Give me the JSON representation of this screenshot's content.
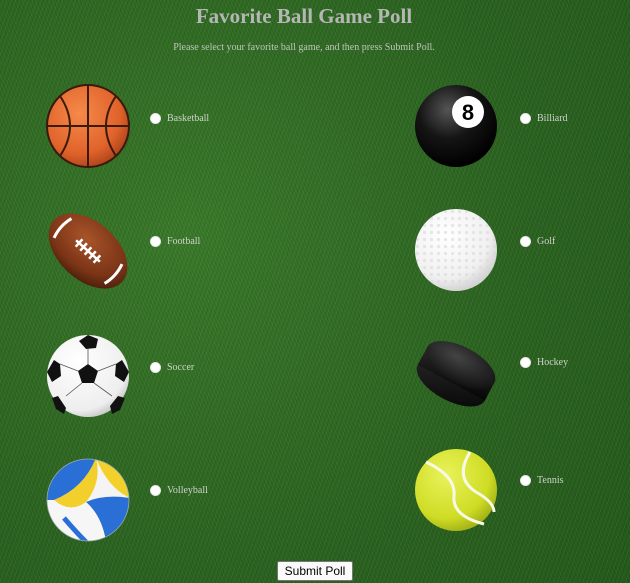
{
  "poll": {
    "title": "Favorite Ball Game Poll",
    "instructions": "Please select your favorite ball game, and then press Submit Poll.",
    "submit_label": "Submit Poll",
    "options": [
      {
        "label": "Basketball",
        "icon": "basketball-icon"
      },
      {
        "label": "Billiard",
        "icon": "billiard-8-ball-icon"
      },
      {
        "label": "Football",
        "icon": "american-football-icon"
      },
      {
        "label": "Golf",
        "icon": "golf-ball-icon"
      },
      {
        "label": "Soccer",
        "icon": "soccer-ball-icon"
      },
      {
        "label": "Hockey",
        "icon": "hockey-puck-icon"
      },
      {
        "label": "Volleyball",
        "icon": "volleyball-icon"
      },
      {
        "label": "Tennis",
        "icon": "tennis-ball-icon"
      }
    ]
  }
}
